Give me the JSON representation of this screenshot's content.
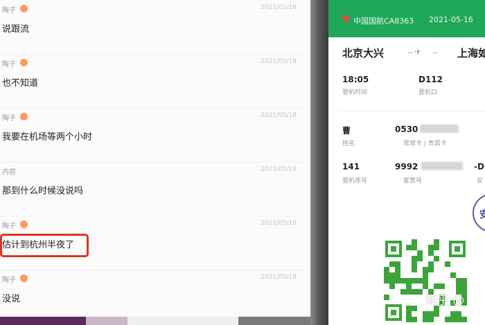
{
  "chat": {
    "messages": [
      {
        "sender": "陶子",
        "time": "2021/05/18",
        "text": "说跟流"
      },
      {
        "sender": "陶子",
        "time": "2021/05/18",
        "text": "也不知道"
      },
      {
        "sender": "陶子",
        "time": "2021/05/18",
        "text": "我要在机场等两个小时"
      },
      {
        "sender": "内容",
        "time": "2021/05/18",
        "text": "那到什么时候没说吗"
      },
      {
        "sender": "陶子",
        "time": "2021/05/18",
        "text": "估计到杭州半夜了"
      },
      {
        "sender": "陶子",
        "time": "2021/05/18",
        "text": "没说"
      }
    ],
    "highlight_color": "#e0341e"
  },
  "boarding_pass": {
    "airline": "中国国航CA8363",
    "date": "2021-05-16",
    "from": "北京大兴",
    "to": "上海如",
    "boarding_time_value": "18:05",
    "boarding_time_label": "登机时间",
    "gate_value": "D112",
    "gate_label": "登机口",
    "name_value": "曹",
    "name_label": "姓名",
    "card_value": "0530",
    "card_label": "常旅卡 | 贵宾卡",
    "seq_value": "141",
    "seq_label": "登机序号",
    "ticket_value": "9992",
    "ticket_label": "客票号",
    "extra_value": "-D",
    "extra_label": "安",
    "stamp_text": "安",
    "header_color": "#1fa85a",
    "qr_color": "#3ca43a"
  },
  "watermark": "知乎 @"
}
